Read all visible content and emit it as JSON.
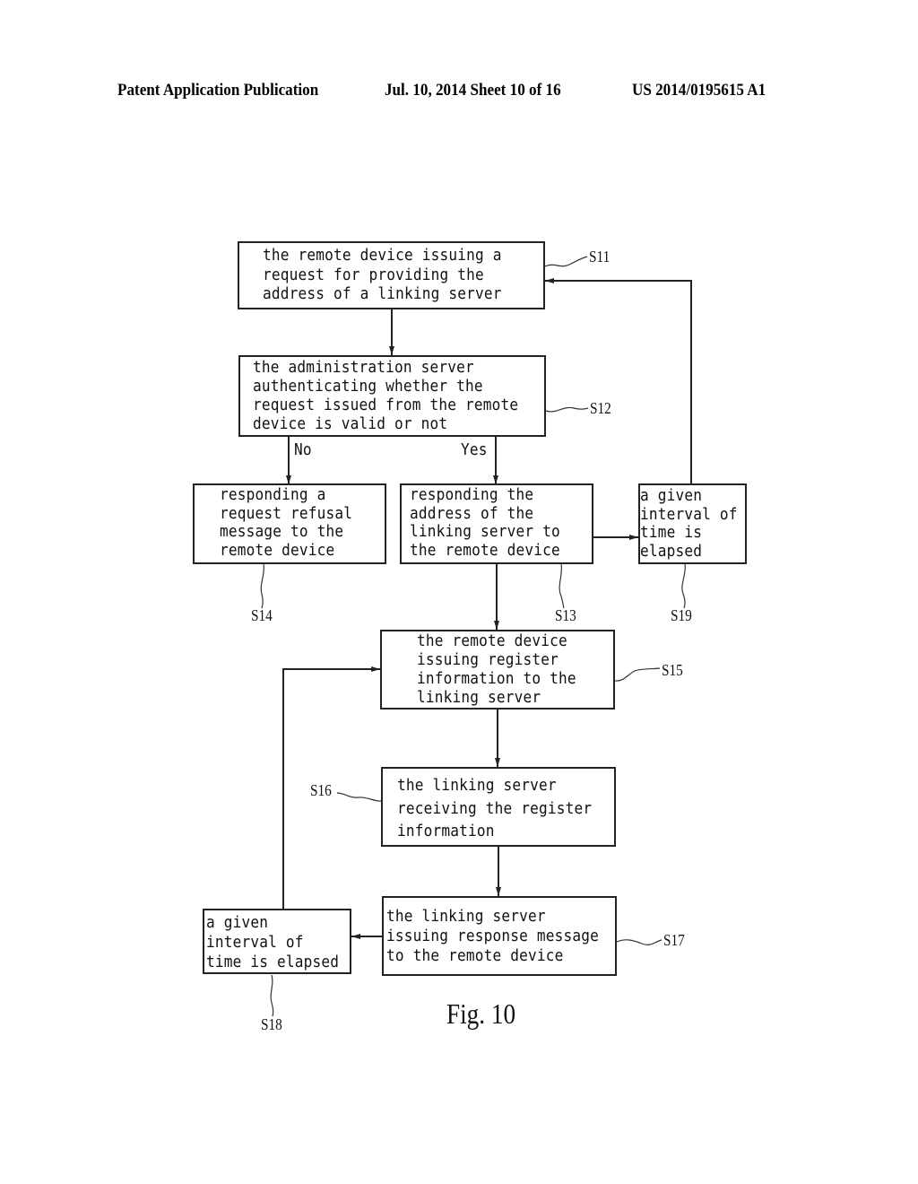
{
  "header": {
    "publication": "Patent Application Publication",
    "date_sheet": "Jul. 10, 2014   Sheet 10 of 16",
    "number": "US 2014/0195615 A1"
  },
  "steps": {
    "s11": {
      "id": "S11",
      "lines": [
        "the remote device issuing a",
        "request for providing the",
        "address of a linking server"
      ]
    },
    "s12": {
      "id": "S12",
      "lines": [
        "the administration server",
        "authenticating whether the",
        "request issued from the remote",
        "device is valid or not"
      ]
    },
    "s13": {
      "id": "S13",
      "lines": [
        "responding the",
        "address of the",
        "linking server to",
        "the remote device"
      ]
    },
    "s14": {
      "id": "S14",
      "lines": [
        "responding a",
        "request refusal",
        "message to the",
        "remote device"
      ]
    },
    "s15": {
      "id": "S15",
      "lines": [
        "the remote device",
        "issuing register",
        "information to the",
        "linking server"
      ]
    },
    "s16": {
      "id": "S16",
      "lines": [
        "the linking server",
        "receiving the register",
        "information"
      ]
    },
    "s17": {
      "id": "S17",
      "lines": [
        "the linking server",
        "issuing response message",
        "to the remote device"
      ]
    },
    "s18": {
      "id": "S18",
      "lines": [
        "a given",
        "interval of",
        "time is elapsed"
      ]
    },
    "s19": {
      "id": "S19",
      "lines": [
        "a given",
        "interval of",
        "time is",
        "elapsed"
      ]
    }
  },
  "branches": {
    "no": "No",
    "yes": "Yes"
  },
  "figure_caption": "Fig. 10"
}
